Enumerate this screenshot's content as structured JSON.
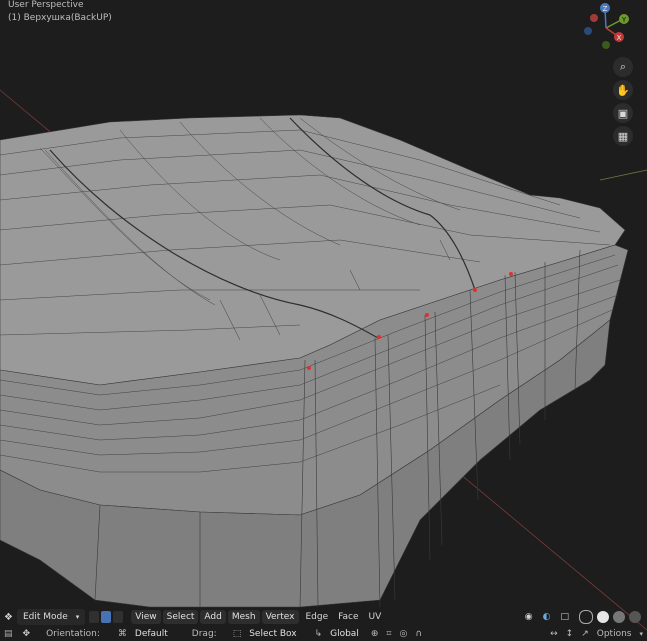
{
  "viewport": {
    "view_name": "User Perspective",
    "object_name": "(1) Верхушка(BackUP)"
  },
  "gizmo": {
    "z": "Z",
    "y": "Y",
    "x": "X"
  },
  "nav_icons": [
    "zoom-icon",
    "hand-icon",
    "camera-icon",
    "grid-icon"
  ],
  "header": {
    "mode": "Edit Mode",
    "menus": [
      "View",
      "Select",
      "Add",
      "Mesh",
      "Vertex",
      "Edge",
      "Face",
      "UV"
    ]
  },
  "tool_settings": {
    "orientation_label": "Orientation:",
    "orientation_value": "Default",
    "drag_label": "Drag:",
    "drag_value": "Select Box",
    "transform_orientation": "Global",
    "options": "Options"
  }
}
